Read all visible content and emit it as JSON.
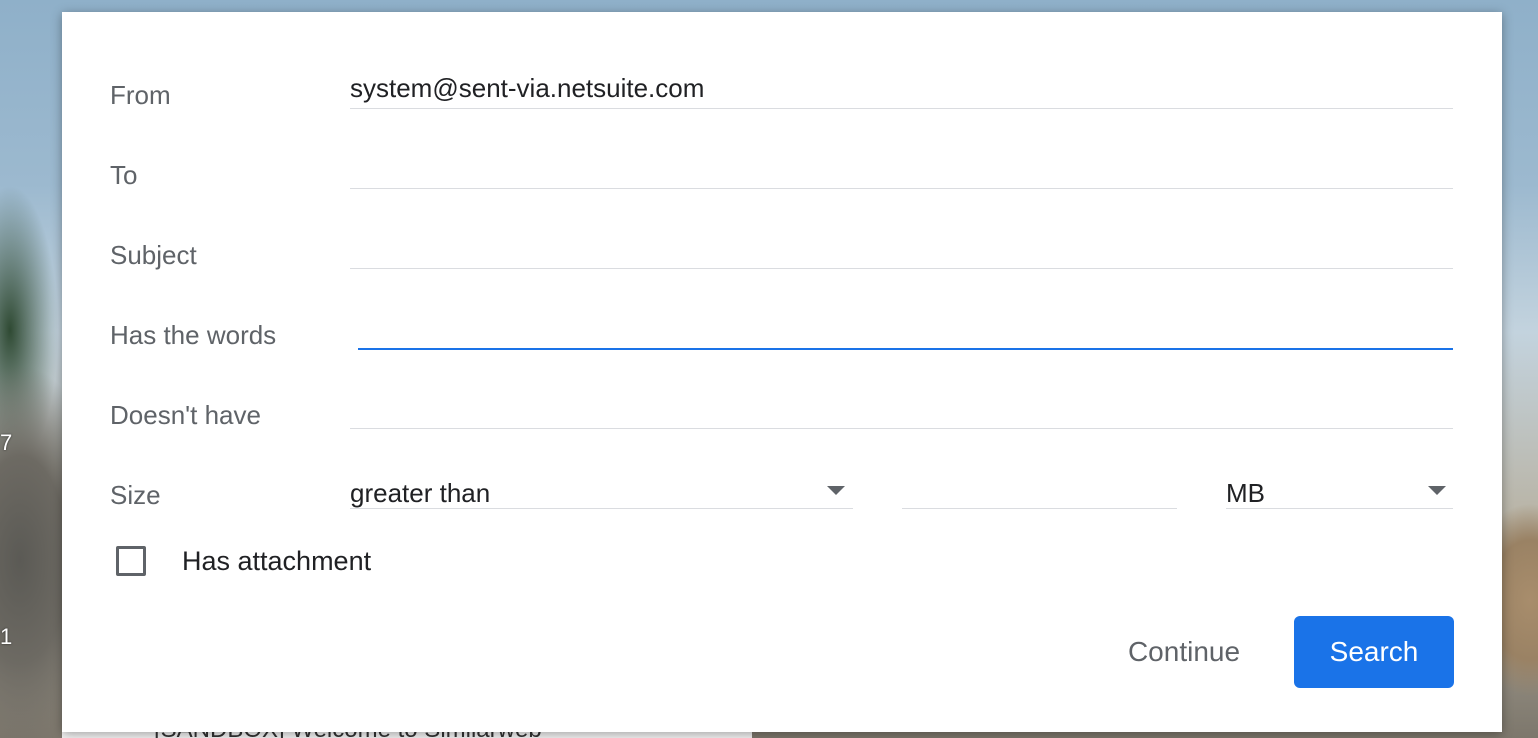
{
  "background": {
    "left_fragments": [
      "7",
      "1"
    ],
    "bottom_text": "[SANDBOX] Welcome to Similarweb"
  },
  "search_form": {
    "from": {
      "label": "From",
      "value": "system@sent-via.netsuite.com"
    },
    "to": {
      "label": "To",
      "value": ""
    },
    "subject": {
      "label": "Subject",
      "value": ""
    },
    "has_words": {
      "label": "Has the words",
      "value": ""
    },
    "doesnt_have": {
      "label": "Doesn't have",
      "value": ""
    },
    "size": {
      "label": "Size",
      "operator": "greater than",
      "value": "",
      "unit": "MB"
    },
    "has_attachment": {
      "label": "Has attachment",
      "checked": false
    },
    "continue_label": "Continue",
    "search_label": "Search"
  },
  "colors": {
    "accent": "#1a73e8",
    "label": "#5f6368",
    "text": "#202124",
    "divider": "#dadce0"
  }
}
